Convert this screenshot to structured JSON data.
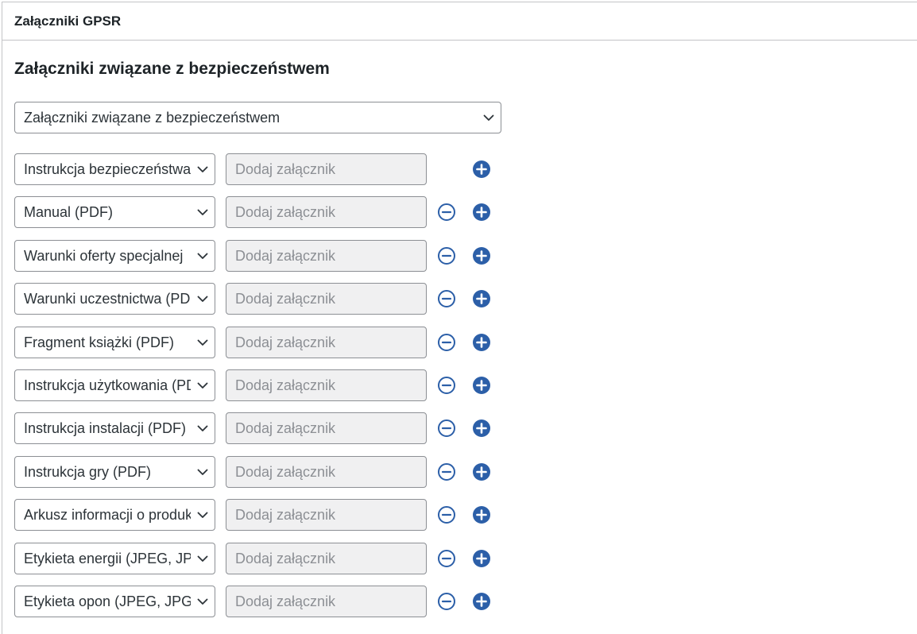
{
  "panel": {
    "title": "Załączniki GPSR"
  },
  "section": {
    "title": "Załączniki związane z bezpieczeństwem",
    "select_value": "Załączniki związane z bezpieczeństwem"
  },
  "rows": [
    {
      "type_label": "Instrukcja bezpieczeństwa",
      "attach_label": "Dodaj załącznik",
      "has_remove": false
    },
    {
      "type_label": "Manual (PDF)",
      "attach_label": "Dodaj załącznik",
      "has_remove": true
    },
    {
      "type_label": "Warunki oferty specjalnej",
      "attach_label": "Dodaj załącznik",
      "has_remove": true
    },
    {
      "type_label": "Warunki uczestnictwa (PDF)",
      "attach_label": "Dodaj załącznik",
      "has_remove": true
    },
    {
      "type_label": "Fragment książki (PDF)",
      "attach_label": "Dodaj załącznik",
      "has_remove": true
    },
    {
      "type_label": "Instrukcja użytkowania (PDF)",
      "attach_label": "Dodaj załącznik",
      "has_remove": true
    },
    {
      "type_label": "Instrukcja instalacji (PDF)",
      "attach_label": "Dodaj załącznik",
      "has_remove": true
    },
    {
      "type_label": "Instrukcja gry (PDF)",
      "attach_label": "Dodaj załącznik",
      "has_remove": true
    },
    {
      "type_label": "Arkusz informacji o produkcie",
      "attach_label": "Dodaj załącznik",
      "has_remove": true
    },
    {
      "type_label": "Etykieta energii (JPEG, JPG)",
      "attach_label": "Dodaj załącznik",
      "has_remove": true
    },
    {
      "type_label": "Etykieta opon (JPEG, JPG)",
      "attach_label": "Dodaj załącznik",
      "has_remove": true
    }
  ],
  "icons": {
    "chevron": "chevron-down-icon",
    "remove": "minus-circle-icon",
    "add": "plus-circle-icon"
  },
  "colors": {
    "accent": "#2c5fa8",
    "border": "#8c8f94",
    "field_bg": "#f0f0f1",
    "placeholder": "#8c8f94"
  }
}
